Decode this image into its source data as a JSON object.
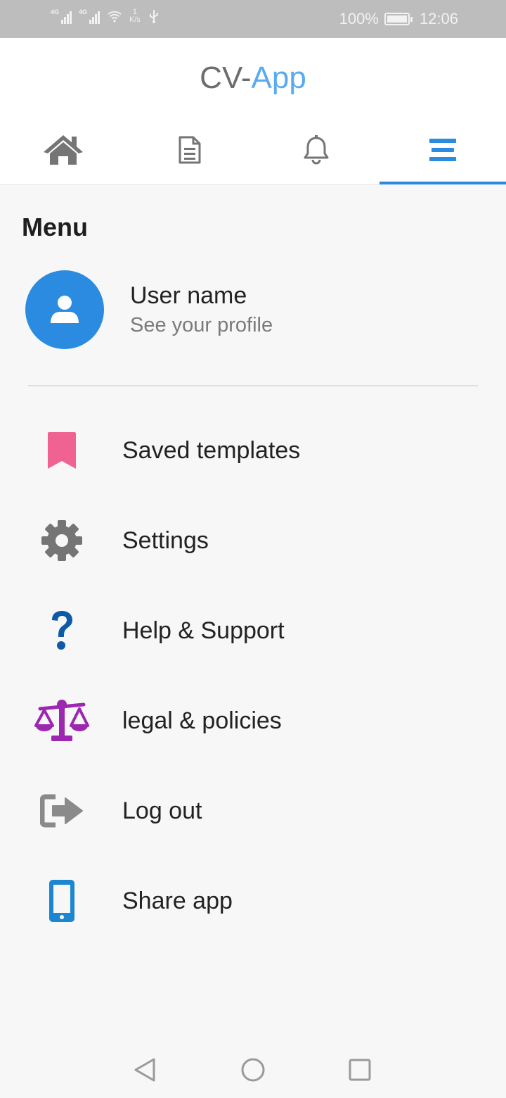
{
  "status_bar": {
    "net1": "4G",
    "net2": "4G",
    "speed_value": "1",
    "speed_unit": "K/s",
    "battery": "100%",
    "time": "12:06"
  },
  "app": {
    "title_part1": "CV-",
    "title_part2": "App",
    "accent_color": "#2a8be0"
  },
  "tabs": [
    {
      "icon": "home-icon",
      "active": false
    },
    {
      "icon": "document-icon",
      "active": false
    },
    {
      "icon": "bell-icon",
      "active": false
    },
    {
      "icon": "menu-icon",
      "active": true
    }
  ],
  "menu": {
    "title": "Menu",
    "profile": {
      "name": "User name",
      "subtitle": "See your profile"
    },
    "items": [
      {
        "label": "Saved templates",
        "icon": "bookmark-icon",
        "color": "#f06292"
      },
      {
        "label": "Settings",
        "icon": "gear-icon",
        "color": "#757575"
      },
      {
        "label": "Help & Support",
        "icon": "question-icon",
        "color": "#0d5aa7"
      },
      {
        "label": "legal & policies",
        "icon": "balance-scale-icon",
        "color": "#9c27b0"
      },
      {
        "label": "Log out",
        "icon": "logout-icon",
        "color": "#8a8a8a"
      },
      {
        "label": "Share app",
        "icon": "phone-icon",
        "color": "#1c86d0"
      }
    ]
  },
  "nav_bar": [
    "back-icon",
    "home-circle-icon",
    "recents-icon"
  ]
}
